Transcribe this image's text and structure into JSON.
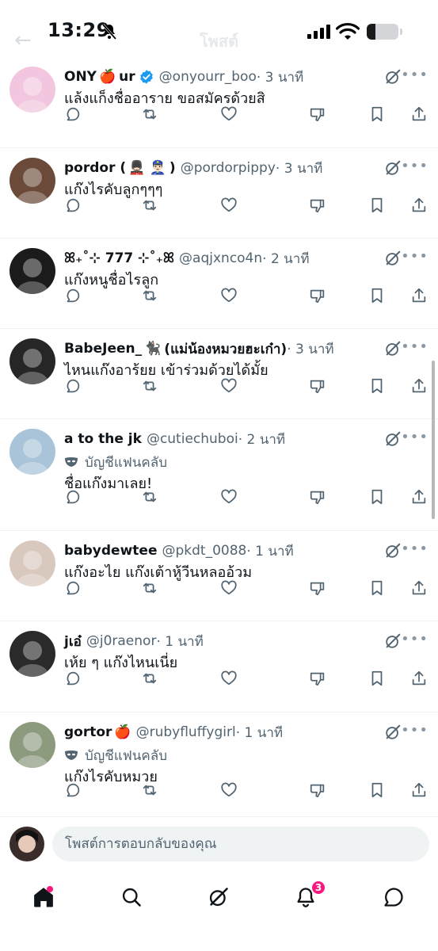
{
  "status_bar": {
    "time": "13:29",
    "battery_level": 0.28
  },
  "header": {
    "title": "โพสต์"
  },
  "replies": [
    {
      "display_name": "ONY",
      "display_name_suffix": "ur",
      "emoji": "🍎",
      "verified": true,
      "handle": "@onyourr_boo",
      "time": "· 3 นาที",
      "fan_label": "",
      "text": "แล้งแก็งชื่ออาราย ขอสมัครด้วยสิ",
      "avatar_color": "#f2c6de"
    },
    {
      "display_name": "pordor (",
      "display_name_suffix": ")",
      "emoji": "💂🏻‍♂️ 👮🏻‍♂️",
      "verified": false,
      "handle": "@pordorpippy",
      "time": "· 3 นาที",
      "fan_label": "",
      "text": "แก๊งไรคับลูกๆๆๆ",
      "avatar_color": "#6b4a3a"
    },
    {
      "display_name": "ꕤ₊˚⊹ 777 ⊹˚₊ꕤ",
      "display_name_suffix": "",
      "emoji": "",
      "verified": false,
      "handle": "@aqjxnco4n",
      "time": "· 2 นาที",
      "fan_label": "",
      "text": "แก๊งหนูชื่อไรลูก",
      "avatar_color": "#1b1b1b"
    },
    {
      "display_name": "BabeJeen_",
      "display_name_suffix": "(แม่น้องหมวยฮะเก๋า)",
      "emoji": "🐈‍⬛",
      "verified": false,
      "handle": "",
      "time": "· 3 นาที",
      "fan_label": "",
      "text": "ไหนแก๊งอาร้ยย เข้าร่วมด้วยได้มั้ย",
      "avatar_color": "#262626"
    },
    {
      "display_name": "a to the jk",
      "display_name_suffix": "",
      "emoji": "",
      "verified": false,
      "handle": "@cutiechuboi",
      "time": "· 2 นาที",
      "fan_label": "บัญชีแฟนคลับ",
      "text": "ชื่อแก๊งมาเลย!",
      "avatar_color": "#a9c4d8"
    },
    {
      "display_name": "babydewtee",
      "display_name_suffix": "",
      "emoji": "",
      "verified": false,
      "handle": "@pkdt_0088",
      "time": "· 1 นาที",
      "fan_label": "",
      "text": "แก๊งอะไย แก๊งเต้าหู้วีนหลออ้วม",
      "avatar_color": "#d9c8bd"
    },
    {
      "display_name": "jเอ๋",
      "display_name_suffix": "",
      "emoji": "",
      "verified": false,
      "handle": "@j0raenor",
      "time": "· 1 นาที",
      "fan_label": "",
      "text": "เห้ย ๆ แก๊งไหนเนี่ย",
      "avatar_color": "#2a2a2a"
    },
    {
      "display_name": "gortor",
      "display_name_suffix": "",
      "emoji": "🍎",
      "verified": false,
      "handle": "@rubyfluffygirl",
      "time": "· 1 นาที",
      "fan_label": "บัญชีแฟนคลับ",
      "text": "แก๊งไรคับหมวย",
      "avatar_color": "#8c9a7e"
    }
  ],
  "composer": {
    "placeholder": "โพสต์การตอบกลับของคุณ"
  },
  "bottom_nav": {
    "items": [
      {
        "name": "home",
        "icon": "home-icon",
        "active": true
      },
      {
        "name": "search",
        "icon": "search-icon"
      },
      {
        "name": "grok",
        "icon": "grok-icon"
      },
      {
        "name": "notifications",
        "icon": "bell-icon",
        "badge": "3"
      },
      {
        "name": "messages",
        "icon": "message-icon"
      }
    ]
  },
  "colors": {
    "text": "#0f1419",
    "secondary": "#536471",
    "verified": "#1d9bf0",
    "badge": "#f91880"
  }
}
